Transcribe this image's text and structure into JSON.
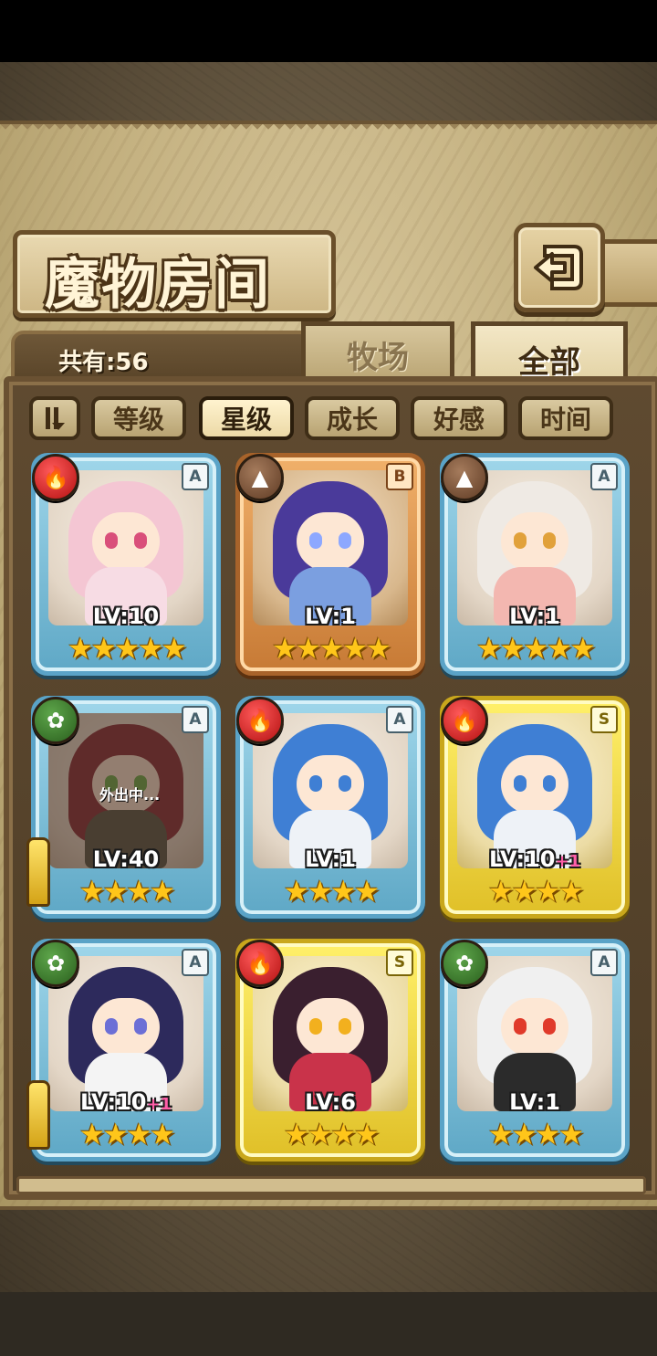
{
  "title": "魔物房间",
  "count_label": "共有:56",
  "tabs": [
    {
      "label": "牧场",
      "active": false
    },
    {
      "label": "全部",
      "active": true
    }
  ],
  "sort_buttons": [
    {
      "label": "等级",
      "active": false
    },
    {
      "label": "星级",
      "active": true
    },
    {
      "label": "成长",
      "active": false
    },
    {
      "label": "好感",
      "active": false
    },
    {
      "label": "时间",
      "active": false
    }
  ],
  "icons": {
    "back": "back-arrow-icon",
    "sort_toggle": "sort-order-icon",
    "fire": "fire-element-icon",
    "earth": "earth-element-icon",
    "wood": "leaf-element-icon",
    "sword": "sword-icon"
  },
  "colors": {
    "frame_blue": "#5aa3c7",
    "frame_bronze": "#a8632a",
    "frame_gold": "#c9a71c",
    "star": "#ffc61a",
    "plus": "#ff5ea8"
  },
  "monsters": [
    {
      "level": "LV:10",
      "plus": "",
      "rank": "A",
      "element": "fire",
      "stars": "★★★★★",
      "frame": "blue",
      "hair": "#f4c6d3",
      "eyes": "#d94f7a",
      "outfit": "#f7dce4",
      "status": "",
      "equipped": false
    },
    {
      "level": "LV:1",
      "plus": "",
      "rank": "B",
      "element": "earth",
      "stars": "★★★★★",
      "frame": "bronze",
      "hair": "#4a3a9a",
      "eyes": "#8da8ff",
      "outfit": "#7b9fe0",
      "status": "",
      "equipped": false
    },
    {
      "level": "LV:1",
      "plus": "",
      "rank": "A",
      "element": "earth",
      "stars": "★★★★★",
      "frame": "blue",
      "hair": "#efeae4",
      "eyes": "#e1a13a",
      "outfit": "#f3b7b0",
      "status": "",
      "equipped": false
    },
    {
      "level": "LV:40",
      "plus": "",
      "rank": "A",
      "element": "wood",
      "stars": "★★★★",
      "frame": "blue",
      "hair": "#8a2f3a",
      "eyes": "#6eb04e",
      "outfit": "#5a5a4a",
      "status": "外出中...",
      "equipped": true
    },
    {
      "level": "LV:1",
      "plus": "",
      "rank": "A",
      "element": "fire",
      "stars": "★★★★",
      "frame": "blue",
      "hair": "#3f7fd4",
      "eyes": "#3f7fd4",
      "outfit": "#eef2f7",
      "status": "",
      "equipped": false
    },
    {
      "level": "LV:10",
      "plus": "+1",
      "rank": "S",
      "element": "fire",
      "stars": "★★★★",
      "frame": "gold",
      "hair": "#3f7fd4",
      "eyes": "#3f7fd4",
      "outfit": "#eef2f7",
      "status": "",
      "equipped": false
    },
    {
      "level": "LV:10",
      "plus": "+1",
      "rank": "A",
      "element": "wood",
      "stars": "★★★★",
      "frame": "blue",
      "hair": "#2d2a5c",
      "eyes": "#6c6fd6",
      "outfit": "#f4f4f4",
      "status": "",
      "equipped": true
    },
    {
      "level": "LV:6",
      "plus": "",
      "rank": "S",
      "element": "fire",
      "stars": "★★★★",
      "frame": "gold",
      "hair": "#3a1f2f",
      "eyes": "#f2b01e",
      "outfit": "#c9334a",
      "status": "",
      "equipped": false
    },
    {
      "level": "LV:1",
      "plus": "",
      "rank": "A",
      "element": "wood",
      "stars": "★★★★",
      "frame": "blue",
      "hair": "#f0f0f0",
      "eyes": "#e03a2a",
      "outfit": "#2b2b2b",
      "status": "",
      "equipped": false
    }
  ]
}
